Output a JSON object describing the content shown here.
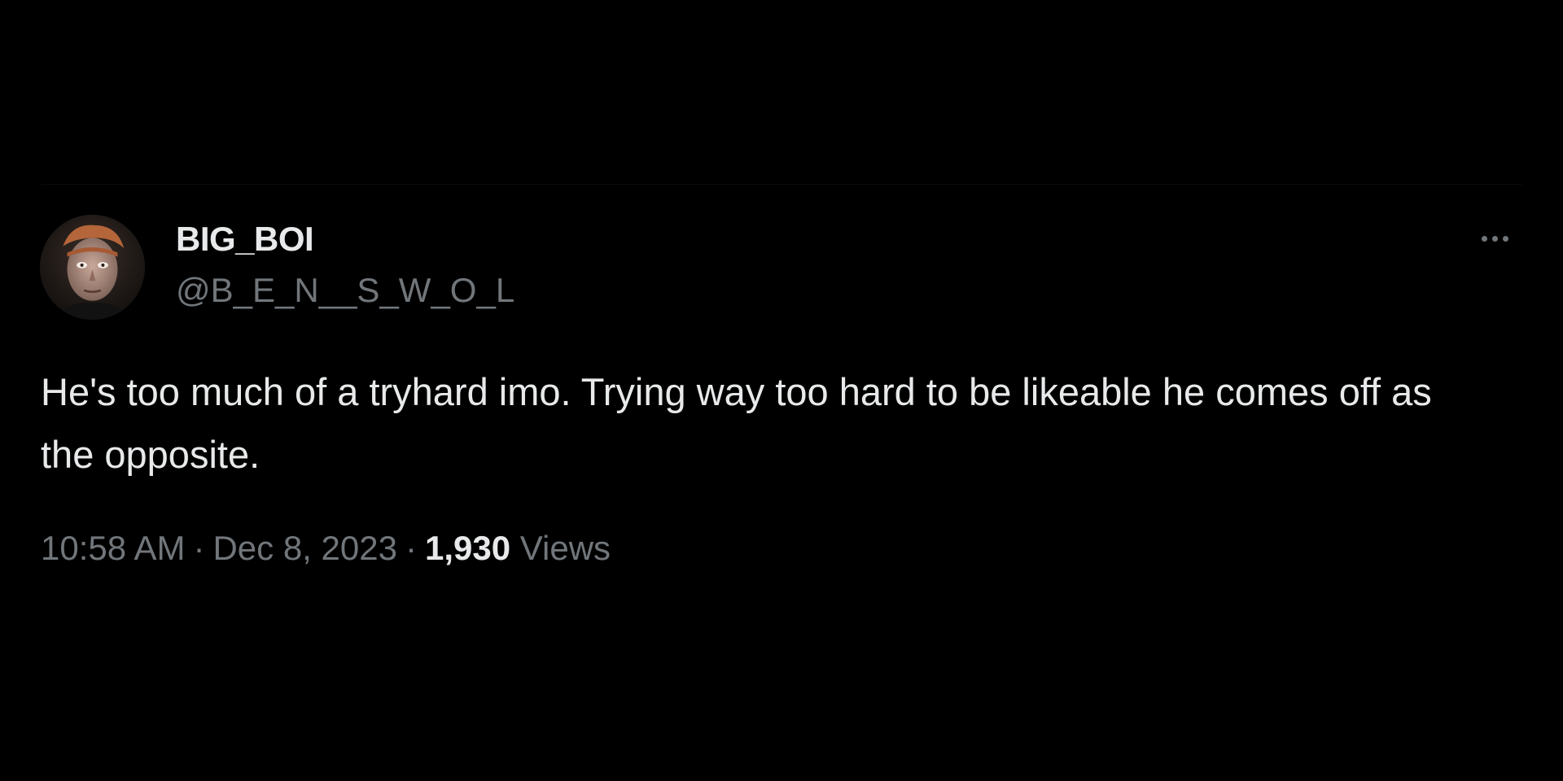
{
  "tweet": {
    "author": {
      "display_name": "BIG_BOI",
      "handle": "@B_E_N__S_W_O_L",
      "avatar_icon": "user-avatar-photo"
    },
    "more_icon": "more-dots-icon",
    "text": "He's too much of a tryhard imo. Trying way too hard to be likeable he comes off as the opposite.",
    "meta": {
      "time": "10:58 AM",
      "separator": "·",
      "date": "Dec 8, 2023",
      "views_count": "1,930",
      "views_label": "Views"
    }
  },
  "colors": {
    "background": "#000000",
    "primary_text": "#e7e9ea",
    "secondary_text": "#71767b"
  }
}
